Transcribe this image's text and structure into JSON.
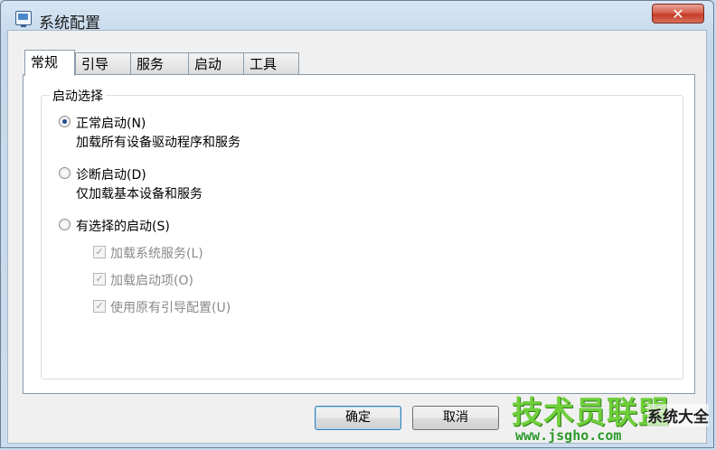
{
  "window": {
    "title": "系统配置",
    "close_label": "✕"
  },
  "tabs": [
    {
      "label": "常规",
      "active": true
    },
    {
      "label": "引导",
      "active": false
    },
    {
      "label": "服务",
      "active": false
    },
    {
      "label": "启动",
      "active": false
    },
    {
      "label": "工具",
      "active": false
    }
  ],
  "startup_selection": {
    "group_label": "启动选择",
    "options": [
      {
        "label": "正常启动(N)",
        "description": "加载所有设备驱动程序和服务",
        "checked": true
      },
      {
        "label": "诊断启动(D)",
        "description": "仅加载基本设备和服务",
        "checked": false
      },
      {
        "label": "有选择的启动(S)",
        "description": "",
        "checked": false
      }
    ],
    "selective_items": [
      {
        "label": "加载系统服务(L)",
        "checked": true,
        "enabled": false
      },
      {
        "label": "加载启动项(O)",
        "checked": true,
        "enabled": false
      },
      {
        "label": "使用原有引导配置(U)",
        "checked": true,
        "enabled": false
      }
    ]
  },
  "buttons": {
    "ok": "确定",
    "cancel": "取消"
  },
  "watermark": {
    "brand": "技术员联盟",
    "url": "www.jsgho.com",
    "badge": "系统大全"
  },
  "colors": {
    "title_bg": "#c9dced",
    "close_red": "#c43b27",
    "radio_dot": "#1d4e8f",
    "watermark_green": "#6fcf3a"
  }
}
